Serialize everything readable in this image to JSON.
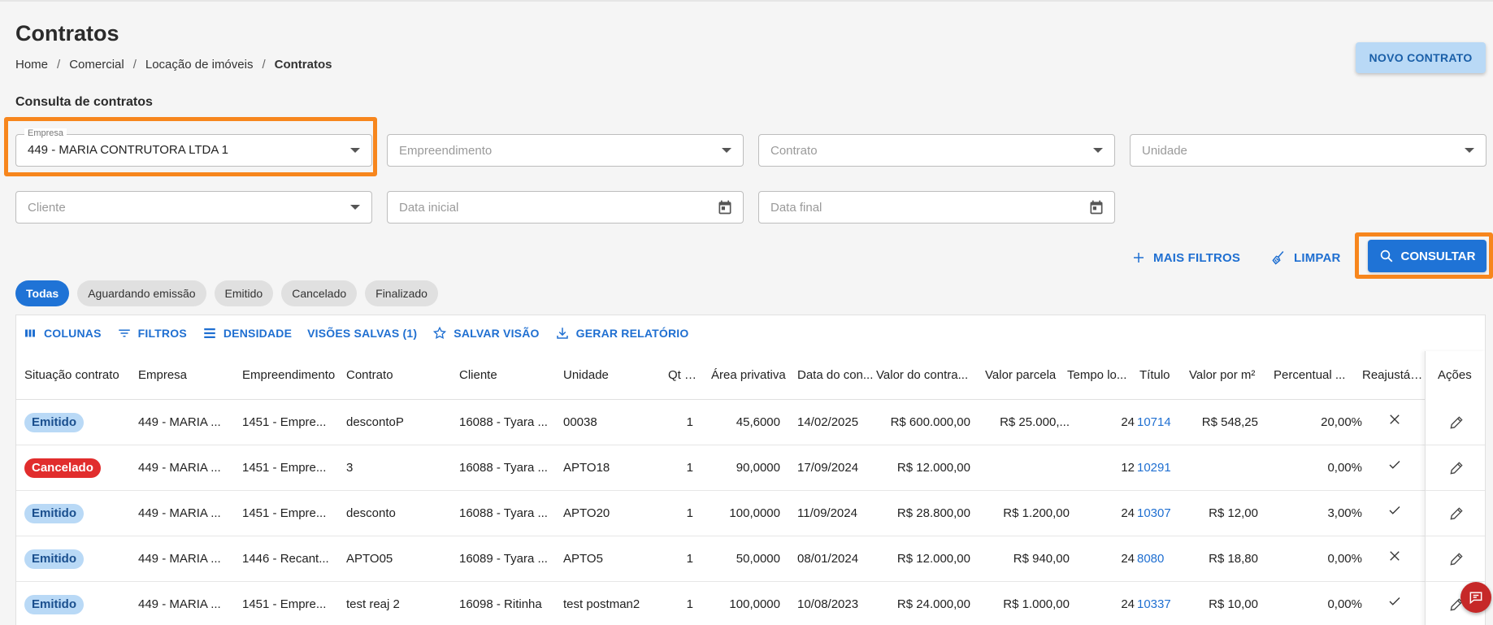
{
  "page": {
    "title": "Contratos",
    "breadcrumb": [
      "Home",
      "Comercial",
      "Locação de imóveis",
      "Contratos"
    ],
    "new_button": "NOVO CONTRATO",
    "section_title": "Consulta de contratos"
  },
  "filters": {
    "empresa_label": "Empresa",
    "empresa_value": "449 - MARIA CONTRUTORA LTDA 1",
    "empreendimento_placeholder": "Empreendimento",
    "contrato_placeholder": "Contrato",
    "unidade_placeholder": "Unidade",
    "cliente_placeholder": "Cliente",
    "data_inicial_placeholder": "Data inicial",
    "data_final_placeholder": "Data final"
  },
  "actions": {
    "mais_filtros": "MAIS FILTROS",
    "limpar": "LIMPAR",
    "consultar": "CONSULTAR"
  },
  "status_chips": [
    "Todas",
    "Aguardando emissão",
    "Emitido",
    "Cancelado",
    "Finalizado"
  ],
  "active_chip": "Todas",
  "toolbar": {
    "colunas": "COLUNAS",
    "filtros": "FILTROS",
    "densidade": "DENSIDADE",
    "visoes_salvas": "VISÕES SALVAS (1)",
    "salvar_visao": "SALVAR VISÃO",
    "gerar_relatorio": "GERAR RELATÓRIO"
  },
  "table": {
    "columns": [
      "Situação contrato",
      "Empresa",
      "Empreendimento",
      "Contrato",
      "Cliente",
      "Unidade",
      "Qt u...",
      "Área privativa",
      "Data do con...",
      "Valor do contra...",
      "Valor parcela",
      "Tempo lo...",
      "Título",
      "Valor por m²",
      "Percentual ...",
      "Reajustável",
      "Ações"
    ],
    "rows": [
      {
        "situacao": "Emitido",
        "status_type": "emitido",
        "empresa": "449 - MARIA ...",
        "empreendimento": "1451 - Empre...",
        "contrato": "descontoP",
        "cliente": "16088 - Tyara ...",
        "unidade": "00038",
        "qt": "1",
        "area": "45,6000",
        "data": "14/02/2025",
        "valor_contrato": "R$ 600.000,00",
        "valor_parcela": "R$ 25.000,...",
        "tempo": "24",
        "titulo": "10714",
        "valor_m2": "R$ 548,25",
        "percentual": "20,00%",
        "reajustavel": "x"
      },
      {
        "situacao": "Cancelado",
        "status_type": "cancelado",
        "empresa": "449 - MARIA ...",
        "empreendimento": "1451 - Empre...",
        "contrato": "3",
        "cliente": "16088 - Tyara ...",
        "unidade": "APTO18",
        "qt": "1",
        "area": "90,0000",
        "data": "17/09/2024",
        "valor_contrato": "R$ 12.000,00",
        "valor_parcela": "",
        "tempo": "12",
        "titulo": "10291",
        "valor_m2": "",
        "percentual": "0,00%",
        "reajustavel": "check"
      },
      {
        "situacao": "Emitido",
        "status_type": "emitido",
        "empresa": "449 - MARIA ...",
        "empreendimento": "1451 - Empre...",
        "contrato": "desconto",
        "cliente": "16088 - Tyara ...",
        "unidade": "APTO20",
        "qt": "1",
        "area": "100,0000",
        "data": "11/09/2024",
        "valor_contrato": "R$ 28.800,00",
        "valor_parcela": "R$ 1.200,00",
        "tempo": "24",
        "titulo": "10307",
        "valor_m2": "R$ 12,00",
        "percentual": "3,00%",
        "reajustavel": "check"
      },
      {
        "situacao": "Emitido",
        "status_type": "emitido",
        "empresa": "449 - MARIA ...",
        "empreendimento": "1446 - Recant...",
        "contrato": "APTO05",
        "cliente": "16089 - Tyara ...",
        "unidade": "APTO5",
        "qt": "1",
        "area": "50,0000",
        "data": "08/01/2024",
        "valor_contrato": "R$ 12.000,00",
        "valor_parcela": "R$ 940,00",
        "tempo": "24",
        "titulo": "8080",
        "valor_m2": "R$ 18,80",
        "percentual": "0,00%",
        "reajustavel": "x"
      },
      {
        "situacao": "Emitido",
        "status_type": "emitido",
        "empresa": "449 - MARIA ...",
        "empreendimento": "1451 - Empre...",
        "contrato": "test reaj 2",
        "cliente": "16098 - Ritinha",
        "unidade": "test postman2",
        "qt": "1",
        "area": "100,0000",
        "data": "10/08/2023",
        "valor_contrato": "R$ 24.000,00",
        "valor_parcela": "R$ 1.000,00",
        "tempo": "24",
        "titulo": "10337",
        "valor_m2": "R$ 10,00",
        "percentual": "0,00%",
        "reajustavel": "check"
      }
    ]
  },
  "colors": {
    "primary": "#1f73d6",
    "highlight": "#f7861d",
    "emitido_bg": "#b9d9f6",
    "cancelado_bg": "#e12d2d",
    "link": "#1f6fd1"
  }
}
